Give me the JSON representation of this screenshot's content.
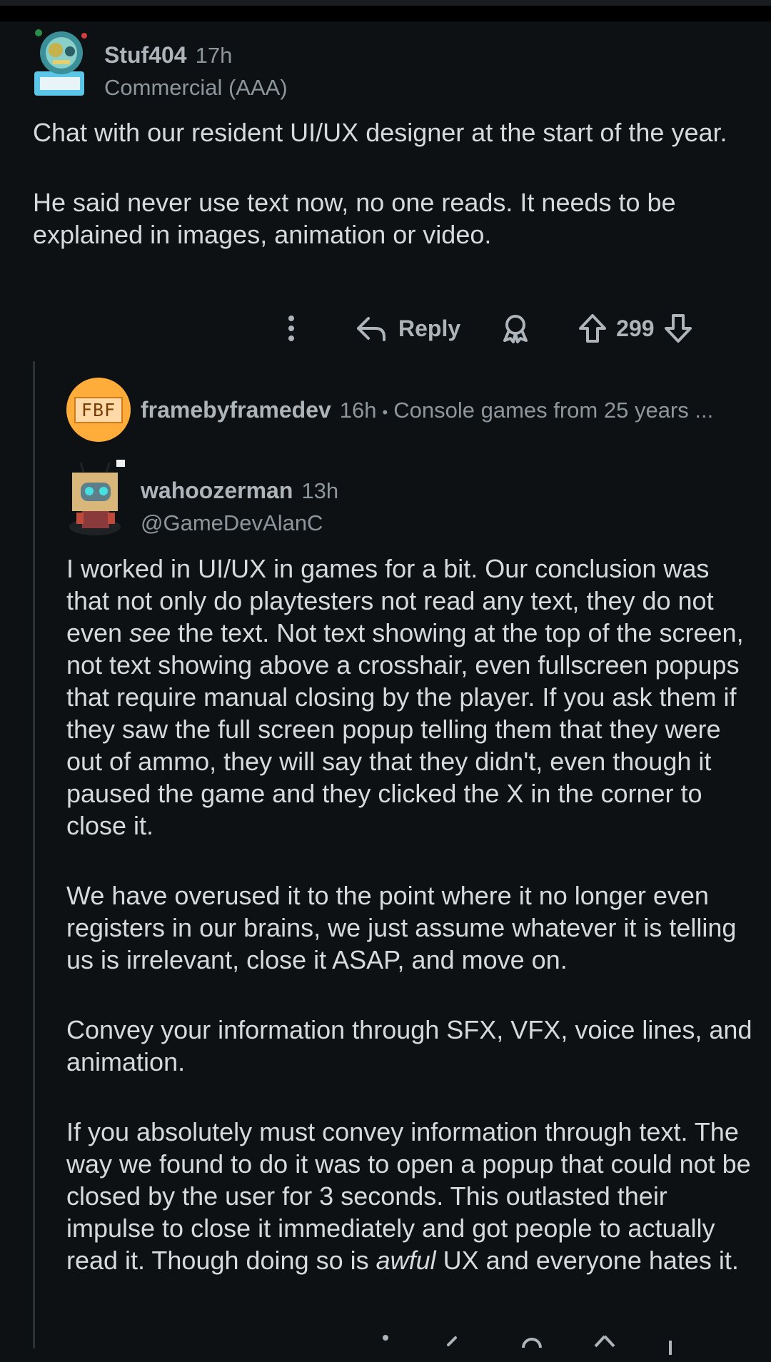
{
  "comment1": {
    "username": "Stuf404",
    "time": "17h",
    "flair": "Commercial (AAA)",
    "paragraphs": [
      "Chat with our resident UI/UX designer at the start of the year.",
      "He said never use text now, no one reads. It needs to be explained in images, animation or video."
    ],
    "actions": {
      "reply_label": "Reply",
      "score": "299"
    }
  },
  "collapsed_reply": {
    "avatar_text": "FBF",
    "username": "framebyframedev",
    "time": "16h",
    "separator": "•",
    "flair": "Console games from 25 years ..."
  },
  "comment2": {
    "username": "wahoozerman",
    "time": "13h",
    "flair": "@GameDevAlanC",
    "p1_before": "I worked in UI/UX in games for a bit. Our conclusion was that not only do playtesters not read any text, they do not even ",
    "p1_emph": "see",
    "p1_after": " the text. Not text showing at the top of the screen, not text showing above a crosshair, even fullscreen popups that require manual closing by the player. If you ask them if they saw the full screen popup telling them that they were out of ammo, they will say that they didn't, even though it paused the game and they clicked the X in the corner to close it.",
    "p2": "We have overused it to the point where it no longer even registers in our brains, we just assume whatever it is telling us is irrelevant, close it ASAP, and move on.",
    "p3": "Convey your information through SFX, VFX, voice lines, and animation.",
    "p4_before": "If you absolutely must convey information through text. The way we found to do it was to open a popup that could not be closed by the user for 3 seconds. This outlasted their impulse to close it immediately and got people to actually read it. Though doing so is ",
    "p4_emph": "awful",
    "p4_after": " UX and everyone hates it."
  },
  "icons": [
    "more-vertical-icon",
    "reply-arrow-icon",
    "award-icon",
    "upvote-icon",
    "downvote-icon"
  ],
  "colors": {
    "background": "#0e1113",
    "text": "#d7dadc",
    "muted": "#8c969c",
    "fbf_avatar": "#ffad3a"
  }
}
